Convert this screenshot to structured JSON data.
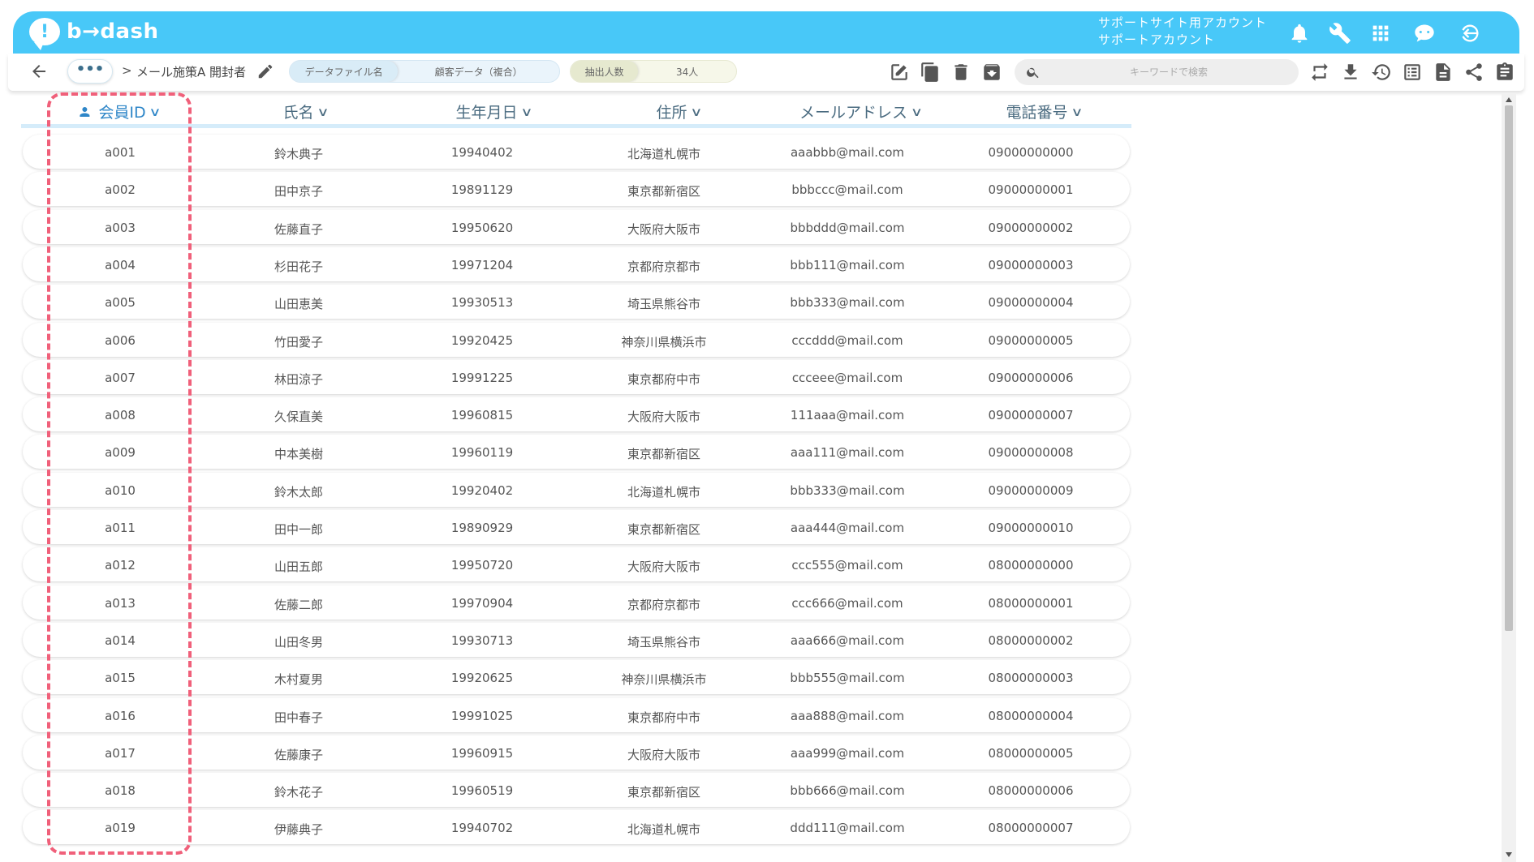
{
  "app": {
    "logo_mark": "!",
    "logo_text": "b→dash",
    "account_line1": "サポートサイト用アカウント",
    "account_line2": "サポートアカウント",
    "top_icons": [
      "bell-icon",
      "wrench-icon",
      "apps-grid-icon",
      "chat-bot-icon",
      "logout-icon"
    ],
    "accent_color": "#48c8f8"
  },
  "toolbar": {
    "more_label": "•••",
    "breadcrumb_sep": ">",
    "breadcrumb_title": "メール施策A 開封者",
    "file_tag_label": "データファイル名",
    "file_tag_value": "顧客データ（複合）",
    "count_tag_label": "抽出人数",
    "count_tag_value": "34人",
    "search_placeholder": "キーワードで検索"
  },
  "table": {
    "columns": [
      "会員ID",
      "氏名",
      "生年月日",
      "住所",
      "メールアドレス",
      "電話番号"
    ],
    "rows": [
      [
        "a001",
        "鈴木典子",
        "19940402",
        "北海道札幌市",
        "aaabbb@mail.com",
        "09000000000"
      ],
      [
        "a002",
        "田中京子",
        "19891129",
        "東京都新宿区",
        "bbbccc@mail.com",
        "09000000001"
      ],
      [
        "a003",
        "佐藤直子",
        "19950620",
        "大阪府大阪市",
        "bbbddd@mail.com",
        "09000000002"
      ],
      [
        "a004",
        "杉田花子",
        "19971204",
        "京都府京都市",
        "bbb111@mail.com",
        "09000000003"
      ],
      [
        "a005",
        "山田恵美",
        "19930513",
        "埼玉県熊谷市",
        "bbb333@mail.com",
        "09000000004"
      ],
      [
        "a006",
        "竹田愛子",
        "19920425",
        "神奈川県横浜市",
        "cccddd@mail.com",
        "09000000005"
      ],
      [
        "a007",
        "林田涼子",
        "19991225",
        "東京都府中市",
        "ccceee@mail.com",
        "09000000006"
      ],
      [
        "a008",
        "久保直美",
        "19960815",
        "大阪府大阪市",
        "111aaa@mail.com",
        "09000000007"
      ],
      [
        "a009",
        "中本美樹",
        "19960119",
        "東京都新宿区",
        "aaa111@mail.com",
        "09000000008"
      ],
      [
        "a010",
        "鈴木太郎",
        "19920402",
        "北海道札幌市",
        "bbb333@mail.com",
        "09000000009"
      ],
      [
        "a011",
        "田中一郎",
        "19890929",
        "東京都新宿区",
        "aaa444@mail.com",
        "09000000010"
      ],
      [
        "a012",
        "山田五郎",
        "19950720",
        "大阪府大阪市",
        "ccc555@mail.com",
        "08000000000"
      ],
      [
        "a013",
        "佐藤二郎",
        "19970904",
        "京都府京都市",
        "ccc666@mail.com",
        "08000000001"
      ],
      [
        "a014",
        "山田冬男",
        "19930713",
        "埼玉県熊谷市",
        "aaa666@mail.com",
        "08000000002"
      ],
      [
        "a015",
        "木村夏男",
        "19920625",
        "神奈川県横浜市",
        "bbb555@mail.com",
        "08000000003"
      ],
      [
        "a016",
        "田中春子",
        "19991025",
        "東京都府中市",
        "aaa888@mail.com",
        "08000000004"
      ],
      [
        "a017",
        "佐藤康子",
        "19960915",
        "大阪府大阪市",
        "aaa999@mail.com",
        "08000000005"
      ],
      [
        "a018",
        "鈴木花子",
        "19960519",
        "東京都新宿区",
        "bbb666@mail.com",
        "08000000006"
      ],
      [
        "a019",
        "伊藤典子",
        "19940702",
        "北海道札幌市",
        "ddd111@mail.com",
        "08000000007"
      ]
    ]
  },
  "annotation": {
    "highlight_color": "#f0607a",
    "highlighted_column": "会員ID"
  }
}
